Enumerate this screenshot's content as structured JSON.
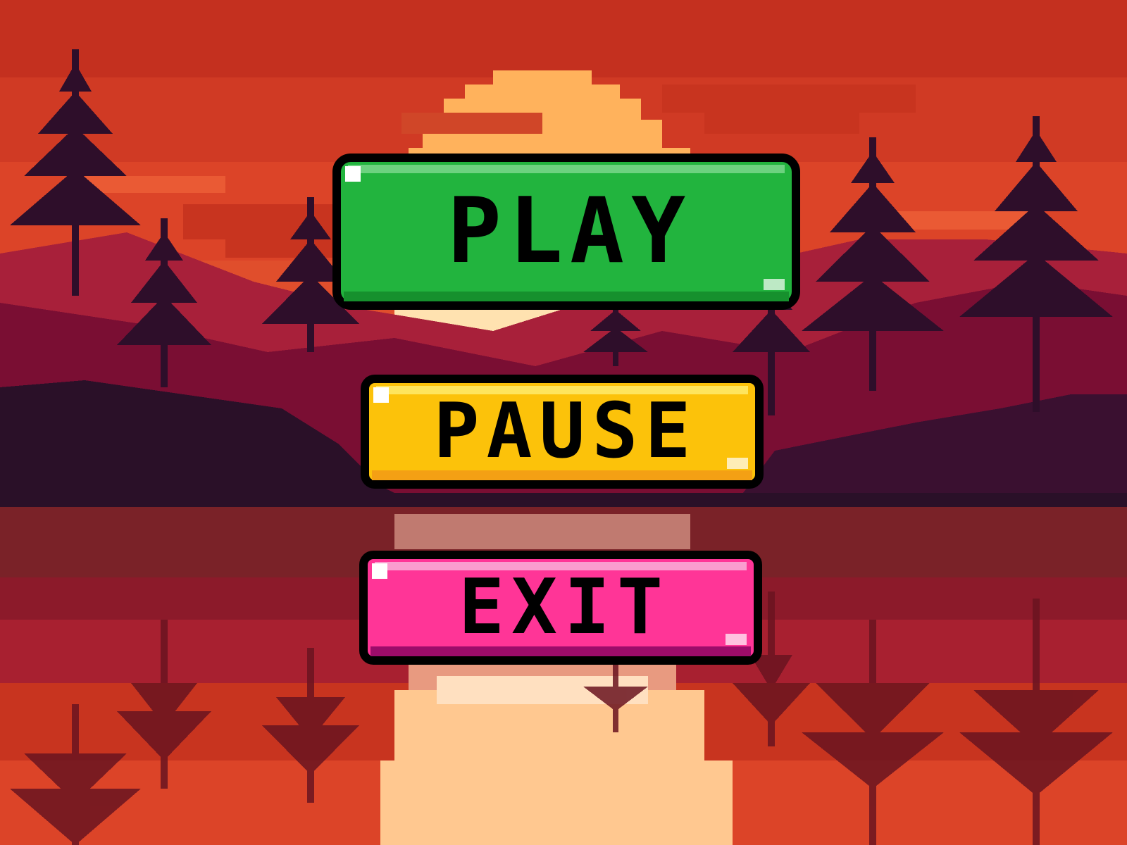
{
  "menu": {
    "play_label": "PLAY",
    "pause_label": "PAUSE",
    "exit_label": "EXIT"
  },
  "colors": {
    "sky": "#c8301f",
    "sun": "#ffb45a",
    "mountain_far": "#a8203a",
    "mountain_near": "#7a0e33",
    "shore": "#2a1028",
    "tree": "#2e0e2a",
    "water": "#7a2228",
    "play_button": "#22b43e",
    "pause_button": "#fcc20a",
    "exit_button": "#ff3597"
  },
  "icons": {
    "background": "sunset-forest-lake-pixel-art"
  }
}
